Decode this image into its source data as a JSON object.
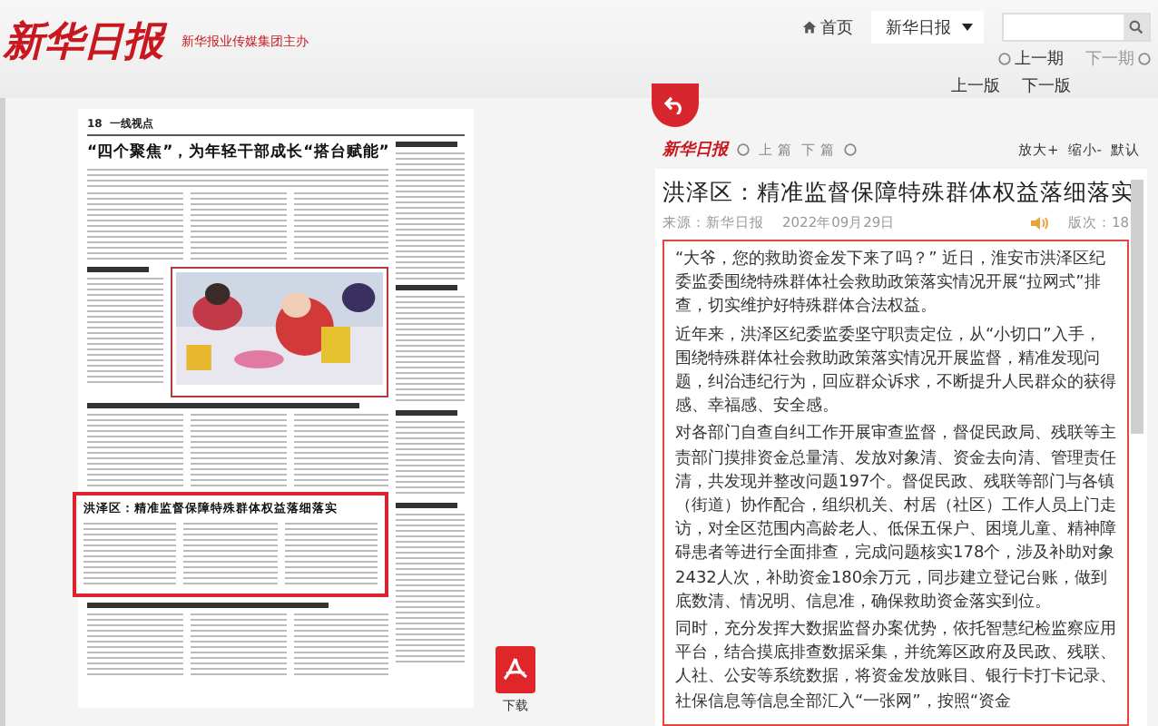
{
  "header": {
    "logo": "新华日报",
    "subtitle": "新华报业传媒集团主办",
    "home": "首页",
    "paper_select": "新华日报",
    "issue_nav": [
      {
        "label": "上一期",
        "disabled": false
      },
      {
        "label": "下一期",
        "disabled": true
      }
    ],
    "page_nav": [
      "上一版",
      "下一版"
    ]
  },
  "newspaper_page": {
    "page_number": "18",
    "section": "一线视点",
    "headline": "“四个聚焦”，为年轻干部成长“搭台赋能”",
    "highlighted_headline": "洪泽区：精准监督保障特殊群体权益落细落实"
  },
  "download": {
    "label": "下载"
  },
  "article_panel": {
    "toolbar": {
      "logo": "新华日报",
      "nav": [
        "上 篇",
        "下 篇"
      ],
      "zoom": [
        "放大+",
        "缩小-",
        "默认"
      ]
    },
    "title": "洪泽区：精准监督保障特殊群体权益落细落实",
    "source": "来源：新华日报",
    "date": "2022年09月29日",
    "edition": "版次：18",
    "paragraphs": [
      "“大爷，您的救助资金发下来了吗？” 近日，淮安市洪泽区纪委监委围绕特殊群体社会救助政策落实情况开展“拉网式”排查，切实维护好特殊群体合法权益。",
      "近年来，洪泽区纪委监委坚守职责定位，从“小切口”入手，围绕特殊群体社会救助政策落实情况开展监督，精准发现问题，纠治违纪行为，回应群众诉求，不断提升人民群众的获得感、幸福感、安全感。",
      "对各部门自查自纠工作开展审查监督，督促民政局、残联等主责部门摸排资金总量清、发放对象清、资金去向清、管理责任清，共发现并整改问题197个。督促民政、残联等部门与各镇（街道）协作配合，组织机关、村居（社区）工作人员上门走访，对全区范围内高龄老人、低保五保户、困境儿童、精神障碍患者等进行全面排查，完成问题核实178个，涉及补助对象2432人次，补助资金180余万元，同步建立登记台账，做到底数清、情况明、信息准，确保救助资金落实到位。",
      "同时，充分发挥大数据监督办案优势，依托智慧纪检监察应用平台，结合摸底排查数据采集，并统筹区政府及民政、残联、人社、公安等系统数据，将资金发放账目、银行卡打卡记录、社保信息等信息全部汇入“一张网”，按照“资金"
    ]
  }
}
